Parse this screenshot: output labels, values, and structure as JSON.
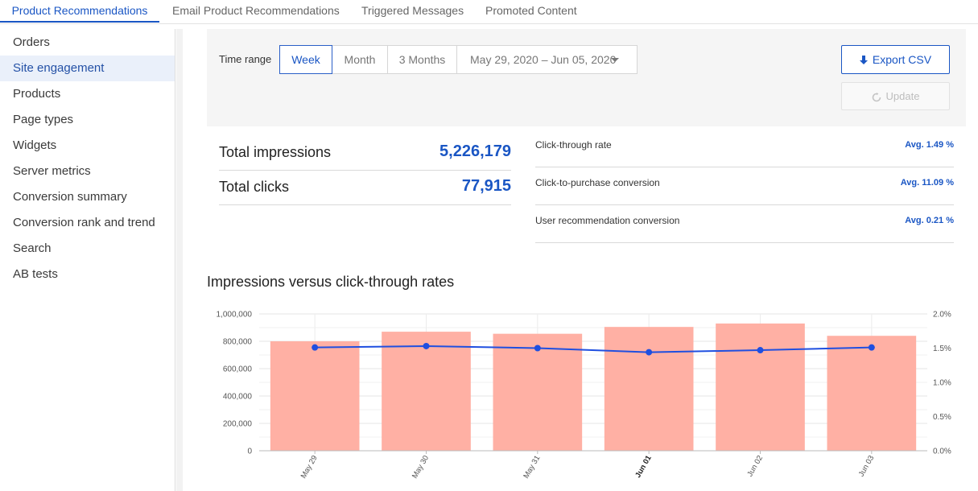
{
  "top_tabs": [
    {
      "label": "Product Recommendations",
      "active": true
    },
    {
      "label": "Email Product Recommendations",
      "active": false
    },
    {
      "label": "Triggered Messages",
      "active": false
    },
    {
      "label": "Promoted Content",
      "active": false
    }
  ],
  "sidebar": {
    "items": [
      {
        "label": "Orders"
      },
      {
        "label": "Site engagement",
        "active": true
      },
      {
        "label": "Products"
      },
      {
        "label": "Page types"
      },
      {
        "label": "Widgets"
      },
      {
        "label": "Server metrics"
      },
      {
        "label": "Conversion summary"
      },
      {
        "label": "Conversion rank and trend"
      },
      {
        "label": "Search"
      },
      {
        "label": "AB tests"
      }
    ]
  },
  "filters": {
    "time_range_label": "Time range",
    "options": [
      "Week",
      "Month",
      "3 Months"
    ],
    "selected": "Week",
    "date_range": "May 29, 2020 – Jun 05, 2020",
    "export_label": "Export CSV",
    "update_label": "Update"
  },
  "stats": {
    "impressions_label": "Total impressions",
    "impressions_value": "5,226,179",
    "clicks_label": "Total clicks",
    "clicks_value": "77,915"
  },
  "rates": [
    {
      "label": "Click-through rate",
      "value": "Avg. 1.49 %"
    },
    {
      "label": "Click-to-purchase conversion",
      "value": "Avg. 11.09 %"
    },
    {
      "label": "User recommendation conversion",
      "value": "Avg. 0.21 %"
    }
  ],
  "chart_title": "Impressions versus click-through rates",
  "colors": {
    "accent": "#1a56c4",
    "bar": "#ffb0a4",
    "line": "#1f4fe0"
  },
  "chart_data": {
    "type": "bar",
    "title": "Impressions versus click-through rates",
    "categories": [
      "May 29",
      "May 30",
      "May 31",
      "Jun 01",
      "Jun 02",
      "Jun 03"
    ],
    "bold_category": "Jun 01",
    "series": [
      {
        "type": "bar",
        "axis": "left",
        "values": [
          800000,
          870000,
          855000,
          905000,
          930000,
          840000
        ]
      },
      {
        "type": "line",
        "axis": "right",
        "values": [
          1.51,
          1.53,
          1.5,
          1.44,
          1.47,
          1.51
        ]
      }
    ],
    "ylim": [
      0,
      1000000
    ],
    "y_ticks": [
      "0",
      "200,000",
      "400,000",
      "600,000",
      "800,000",
      "1,000,000"
    ],
    "y2lim": [
      0,
      2.0
    ],
    "y2_ticks": [
      "0.0%",
      "0.5%",
      "1.0%",
      "1.5%",
      "2.0%"
    ],
    "grid": true
  }
}
